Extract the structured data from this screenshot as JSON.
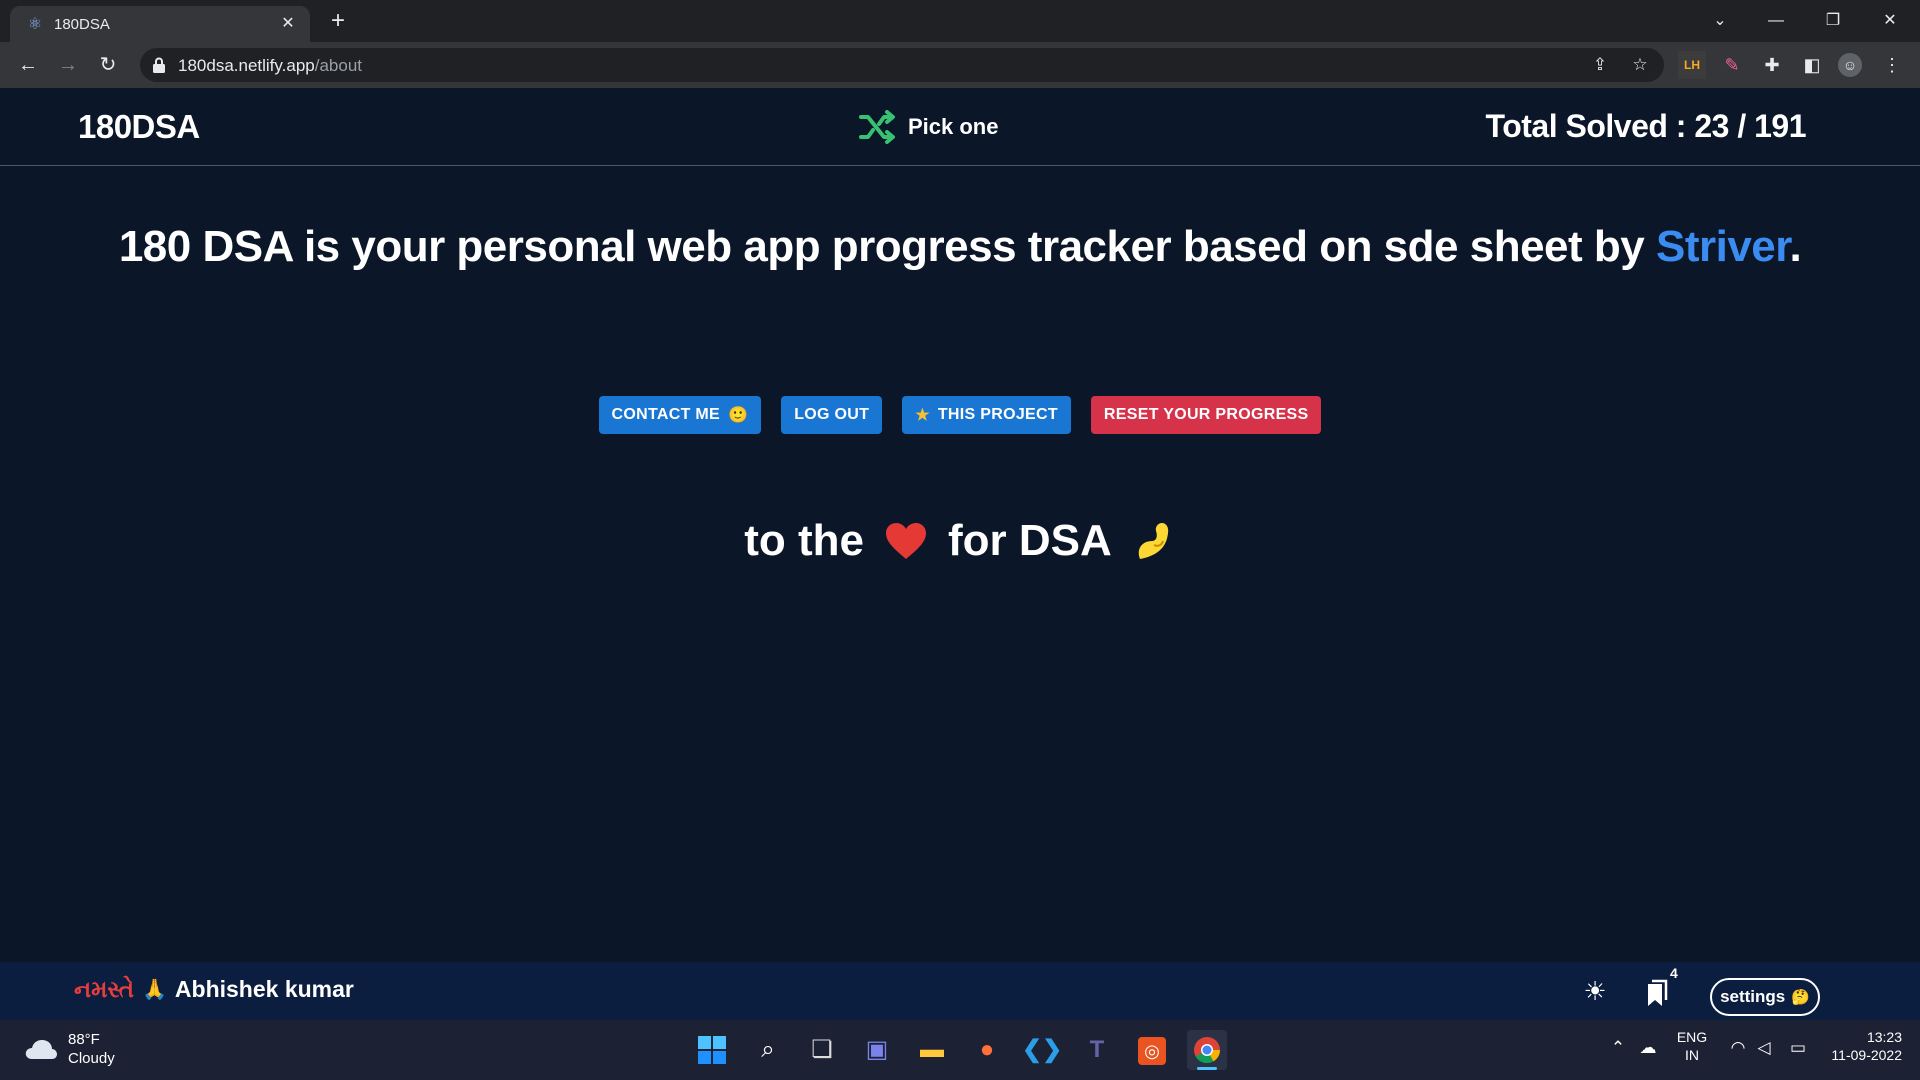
{
  "browser": {
    "tab_title": "180DSA",
    "url_host": "180dsa.netlify.app",
    "url_path": "/about",
    "extension_label": "LH"
  },
  "navbar": {
    "brand": "180DSA",
    "pick_one": "Pick one",
    "total_solved": "Total Solved : 23 / 191"
  },
  "hero": {
    "text": "180 DSA is your personal web app progress tracker based on sde sheet by ",
    "link": "Striver",
    "period": "."
  },
  "actions": {
    "contact": "CONTACT ME",
    "logout": "LOG OUT",
    "star_project": "THIS PROJECT",
    "reset": "RESET YOUR PROGRESS"
  },
  "love": {
    "prefix": "to the",
    "suffix": "for DSA"
  },
  "footer": {
    "greeting_native": "નમસ્તે",
    "name": "Abhishek kumar",
    "notification_count": "4",
    "settings": "settings"
  },
  "taskbar": {
    "temperature": "88°F",
    "weather": "Cloudy",
    "language": "ENG",
    "region": "IN",
    "time": "13:23",
    "date": "11-09-2022"
  },
  "colors": {
    "page_bg": "#0b1628",
    "accent_link": "#3b8cf0",
    "button_blue": "#1976d2",
    "button_red": "#d6334a",
    "shuffle_green": "#38c172",
    "footer_bg": "#0b1e3f"
  }
}
